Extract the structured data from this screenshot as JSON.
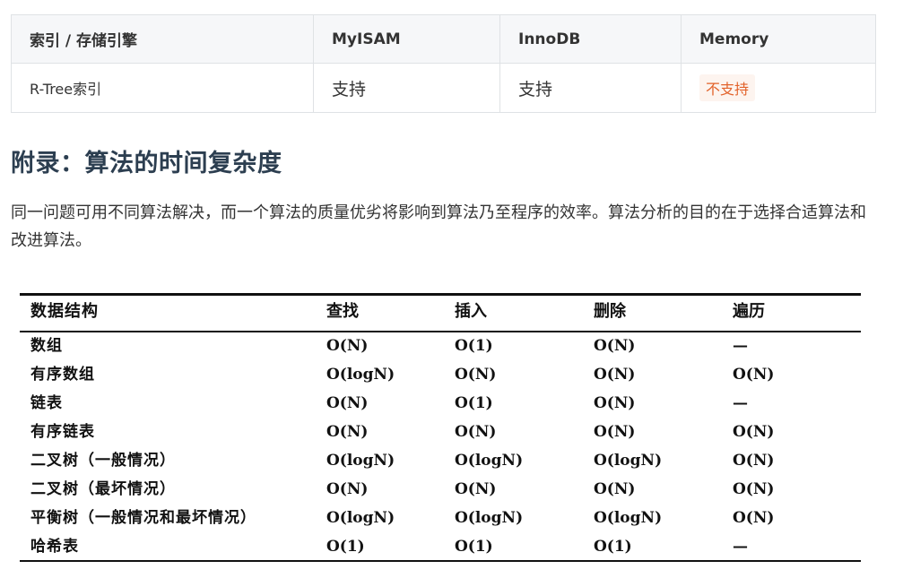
{
  "engine_table": {
    "headers": [
      "索引 / 存储引擎",
      "MyISAM",
      "InnoDB",
      "Memory"
    ],
    "row": {
      "label": "R-Tree索引",
      "myisam": "支持",
      "innodb": "支持",
      "memory": "不支持"
    },
    "colors": {
      "header_bg": "#f6f7f9",
      "border": "#dfe2e5",
      "badge_bg": "#fdf4ef",
      "badge_text": "#e2622a"
    }
  },
  "appendix": {
    "title": "附录：算法的时间复杂度",
    "paragraph": "同一问题可用不同算法解决，而一个算法的质量优劣将影响到算法乃至程序的效率。算法分析的目的在于选择合适算法和改进算法。"
  },
  "complexity_table": {
    "headers": [
      "数据结构",
      "查找",
      "插入",
      "删除",
      "遍历"
    ],
    "rows": [
      [
        "数组",
        "O(N)",
        "O(1)",
        "O(N)",
        "—"
      ],
      [
        "有序数组",
        "O(logN)",
        "O(N)",
        "O(N)",
        "O(N)"
      ],
      [
        "链表",
        "O(N)",
        "O(1)",
        "O(N)",
        "—"
      ],
      [
        "有序链表",
        "O(N)",
        "O(N)",
        "O(N)",
        "O(N)"
      ],
      [
        "二叉树（一般情况）",
        "O(logN)",
        "O(logN)",
        "O(logN)",
        "O(N)"
      ],
      [
        "二叉树（最坏情况）",
        "O(N)",
        "O(N)",
        "O(N)",
        "O(N)"
      ],
      [
        "平衡树（一般情况和最坏情况）",
        "O(logN)",
        "O(logN)",
        "O(logN)",
        "O(N)"
      ],
      [
        "哈希表",
        "O(1)",
        "O(1)",
        "O(1)",
        "—"
      ]
    ]
  }
}
